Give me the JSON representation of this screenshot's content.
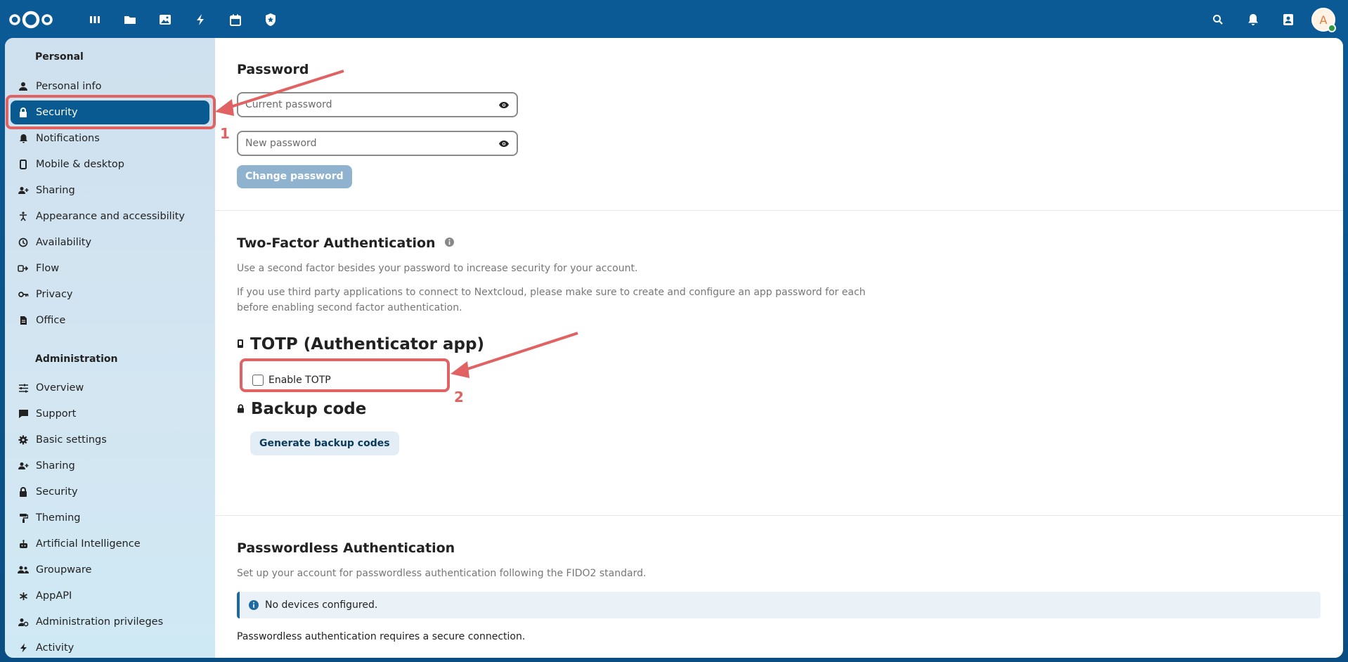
{
  "header": {
    "app_icons": [
      "dashboard-icon",
      "files-icon",
      "photos-icon",
      "activity-icon",
      "calendar-icon",
      "security-shield-icon"
    ],
    "right_icons": [
      "search-icon",
      "bell-icon",
      "contacts-icon"
    ],
    "avatar_letter": "A",
    "accent": "#0a5a92"
  },
  "sidebar": {
    "personal_heading": "Personal",
    "personal_items": [
      {
        "label": "Personal info",
        "icon": "user-icon"
      },
      {
        "label": "Security",
        "icon": "lock-icon",
        "active": true
      },
      {
        "label": "Notifications",
        "icon": "bell-icon"
      },
      {
        "label": "Mobile & desktop",
        "icon": "phone-icon"
      },
      {
        "label": "Sharing",
        "icon": "share-user-icon"
      },
      {
        "label": "Appearance and accessibility",
        "icon": "accessibility-icon"
      },
      {
        "label": "Availability",
        "icon": "clock-icon"
      },
      {
        "label": "Flow",
        "icon": "flow-icon"
      },
      {
        "label": "Privacy",
        "icon": "key-icon"
      },
      {
        "label": "Office",
        "icon": "document-icon"
      }
    ],
    "admin_heading": "Administration",
    "admin_items": [
      {
        "label": "Overview",
        "icon": "sliders-icon"
      },
      {
        "label": "Support",
        "icon": "chat-icon"
      },
      {
        "label": "Basic settings",
        "icon": "gear-icon"
      },
      {
        "label": "Sharing",
        "icon": "share-user-icon"
      },
      {
        "label": "Security",
        "icon": "lock-icon"
      },
      {
        "label": "Theming",
        "icon": "paint-roller-icon"
      },
      {
        "label": "Artificial Intelligence",
        "icon": "robot-icon"
      },
      {
        "label": "Groupware",
        "icon": "group-icon"
      },
      {
        "label": "AppAPI",
        "icon": "asterisk-icon"
      },
      {
        "label": "Administration privileges",
        "icon": "admin-user-icon"
      },
      {
        "label": "Activity",
        "icon": "activity-icon"
      }
    ]
  },
  "password": {
    "title": "Password",
    "current_placeholder": "Current password",
    "new_placeholder": "New password",
    "change_button": "Change password"
  },
  "two_factor": {
    "title": "Two-Factor Authentication",
    "desc1": "Use a second factor besides your password to increase security for your account.",
    "desc2a": "If you use third party applications to connect to Nextcloud, please make sure to create and configure an app password for each",
    "desc2b": "before enabling second factor authentication.",
    "totp_title": "TOTP (Authenticator app)",
    "enable_totp": "Enable TOTP",
    "backup_title": "Backup code",
    "generate_button": "Generate backup codes"
  },
  "passwordless": {
    "title": "Passwordless Authentication",
    "desc": "Set up your account for passwordless authentication following the FIDO2 standard.",
    "notice": "No devices configured.",
    "requirement": "Passwordless authentication requires a secure connection."
  },
  "annotations": {
    "num1": "1",
    "num2": "2",
    "color": "#e06262"
  }
}
